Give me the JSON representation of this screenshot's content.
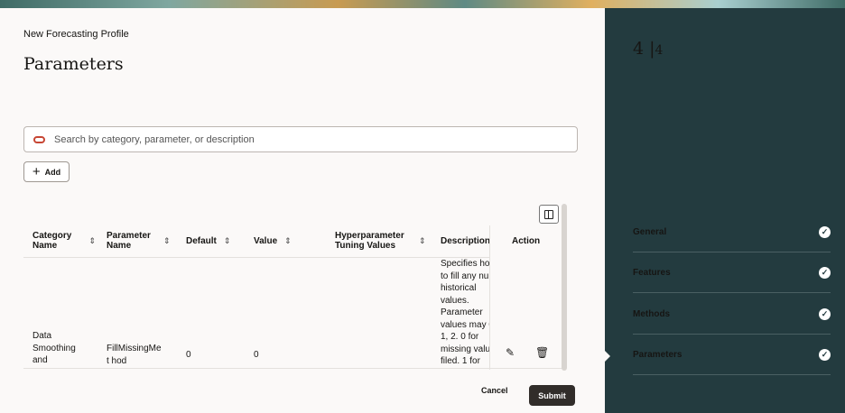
{
  "header": {
    "subtitle": "New Forecasting Profile",
    "title": "Parameters"
  },
  "search": {
    "placeholder": "Search by category, parameter, or description"
  },
  "add_label": "Add",
  "table": {
    "columns": [
      "Category Name",
      "Parameter Name",
      "Default",
      "Value",
      "Hyperparameter Tuning Values",
      "Description",
      "Action"
    ],
    "rows": [
      {
        "category": "Data Smoothing and",
        "parameter": "FillMissingMet hod",
        "default": "0",
        "value": "0",
        "tuning": "",
        "description": "Specifies ho to fill any nu historical values. Parameter values may 0, 1, 2. 0 for missing valu filed. 1 for"
      }
    ]
  },
  "footer": {
    "cancel": "Cancel",
    "submit": "Submit"
  },
  "side": {
    "step": "4",
    "total": "4",
    "items": [
      {
        "label": "General"
      },
      {
        "label": "Features"
      },
      {
        "label": "Methods"
      },
      {
        "label": "Parameters"
      }
    ]
  },
  "colors": {
    "sidebar": "#233b3f",
    "primary": "#312d2a",
    "accent": "#c74634"
  }
}
